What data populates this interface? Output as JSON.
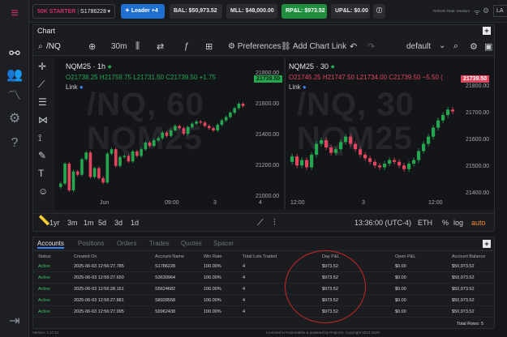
{
  "topbar": {
    "account_label": "50K STARTER",
    "account_id": "S1786228",
    "leader_label": "Leader +4",
    "bal": "BAL: $50,973.52",
    "mll": "MLL: $48,000.00",
    "rpl": "RP&L: $973.52",
    "upl": "UP&L: $0.00",
    "refresh": "Refresh Rate: Medium",
    "lang": "LA",
    "colors": {
      "blue": "#1f6fd1",
      "green": "#1f8f3f",
      "pink": "#c9316b"
    }
  },
  "chart": {
    "tab": "Chart",
    "symbol": "/NQ",
    "interval": "30m",
    "preferences": "Preferences",
    "add_link": "Add Chart Link",
    "layout": "default",
    "left": {
      "title": "NQM25 · 1h",
      "o": "O21738.25",
      "h": "H21759.75",
      "l": "L21731.50",
      "c": "C21739.50",
      "chg": "+1.75",
      "link": "Link",
      "watermark1": "/NQ, 60",
      "watermark2": "NQM25",
      "price_tag": "21739.50",
      "yticks": [
        "21800.00",
        "21600.00",
        "21400.00",
        "21200.00",
        "21000.00"
      ],
      "xticks": [
        "Jun",
        "09:00",
        "3",
        "4"
      ]
    },
    "right": {
      "title": "NQM25 · 30",
      "o": "O21745.25",
      "h": "H21747.50",
      "l": "L21734.00",
      "c": "C21739.50",
      "chg": "−5.50 (",
      "link": "Link",
      "watermark1": "/NQ, 30",
      "watermark2": "NQM25",
      "price_tag": "21739.50",
      "yticks": [
        "21800.00",
        "21700.00",
        "21600.00",
        "21500.00",
        "21400.00"
      ],
      "xticks": [
        "12:00",
        "3",
        "12:00"
      ]
    },
    "ranges": [
      "1yr",
      "3m",
      "1m",
      "5d",
      "3d",
      "1d"
    ],
    "time": "13:36:00 (UTC-4)",
    "eth": "ETH",
    "pct": "%",
    "log": "log",
    "auto": "auto"
  },
  "accounts": {
    "tabs": [
      "Accounts",
      "Positions",
      "Orders",
      "Trades",
      "Quotes",
      "Spacer"
    ],
    "headers": [
      "Status",
      "Created On",
      "Account Name",
      "Win Rate",
      "Total Lots Traded",
      "Day P&L",
      "Open P&L",
      "Account Balance"
    ],
    "rows": [
      [
        "Active",
        "2025-06-03 12:56:27.785",
        "S1786228",
        "100.00%",
        "4",
        "$973.52",
        "$0.00",
        "$50,973.52"
      ],
      [
        "Active",
        "2025-06-03 12:56:27.650",
        "S3630964",
        "100.00%",
        "4",
        "$973.52",
        "$0.00",
        "$50,973.52"
      ],
      [
        "Active",
        "2025-06-03 12:56:28.151",
        "S5624682",
        "100.00%",
        "4",
        "$973.52",
        "$0.00",
        "$50,973.52"
      ],
      [
        "Active",
        "2025-06-03 12:56:27.881",
        "S8928558",
        "100.00%",
        "4",
        "$973.52",
        "$0.00",
        "$50,973.52"
      ],
      [
        "Active",
        "2025-06-03 12:56:27.995",
        "S9962438",
        "100.00%",
        "4",
        "$973.52",
        "$0.00",
        "$50,973.52"
      ]
    ],
    "total_rows": "Total Rows: 5"
  },
  "footer": {
    "version": "Version: 1.17.12",
    "license": "Licensed to FuturesElite & powered by ProjectX. Copyright 2024-2025"
  },
  "chart_data": [
    {
      "type": "candlestick",
      "title": "NQM25 · 1h",
      "ylim": [
        20950,
        21870
      ],
      "candles": [
        21040,
        21220,
        20980,
        21150,
        21120,
        21260,
        21320,
        21100,
        21180,
        21090,
        21050,
        21310,
        21350,
        21200,
        21280,
        21290,
        21240,
        21330,
        21290,
        21350,
        21410,
        21380,
        21430,
        21450,
        21500,
        21470,
        21520,
        21560,
        21540,
        21490,
        21550,
        21580,
        21600,
        21590,
        21560,
        21540,
        21520,
        21570,
        21610,
        21640,
        21680,
        21720,
        21760,
        21740
      ]
    },
    {
      "type": "candlestick",
      "title": "NQM25 · 30",
      "ylim": [
        21320,
        21850
      ],
      "candles": [
        21490,
        21440,
        21470,
        21430,
        21500,
        21560,
        21580,
        21540,
        21510,
        21530,
        21570,
        21600,
        21560,
        21530,
        21500,
        21480,
        21460,
        21440,
        21430,
        21450,
        21470,
        21460,
        21440,
        21420,
        21450,
        21470,
        21520,
        21560,
        21600,
        21650,
        21690,
        21720,
        21750,
        21740
      ]
    }
  ]
}
